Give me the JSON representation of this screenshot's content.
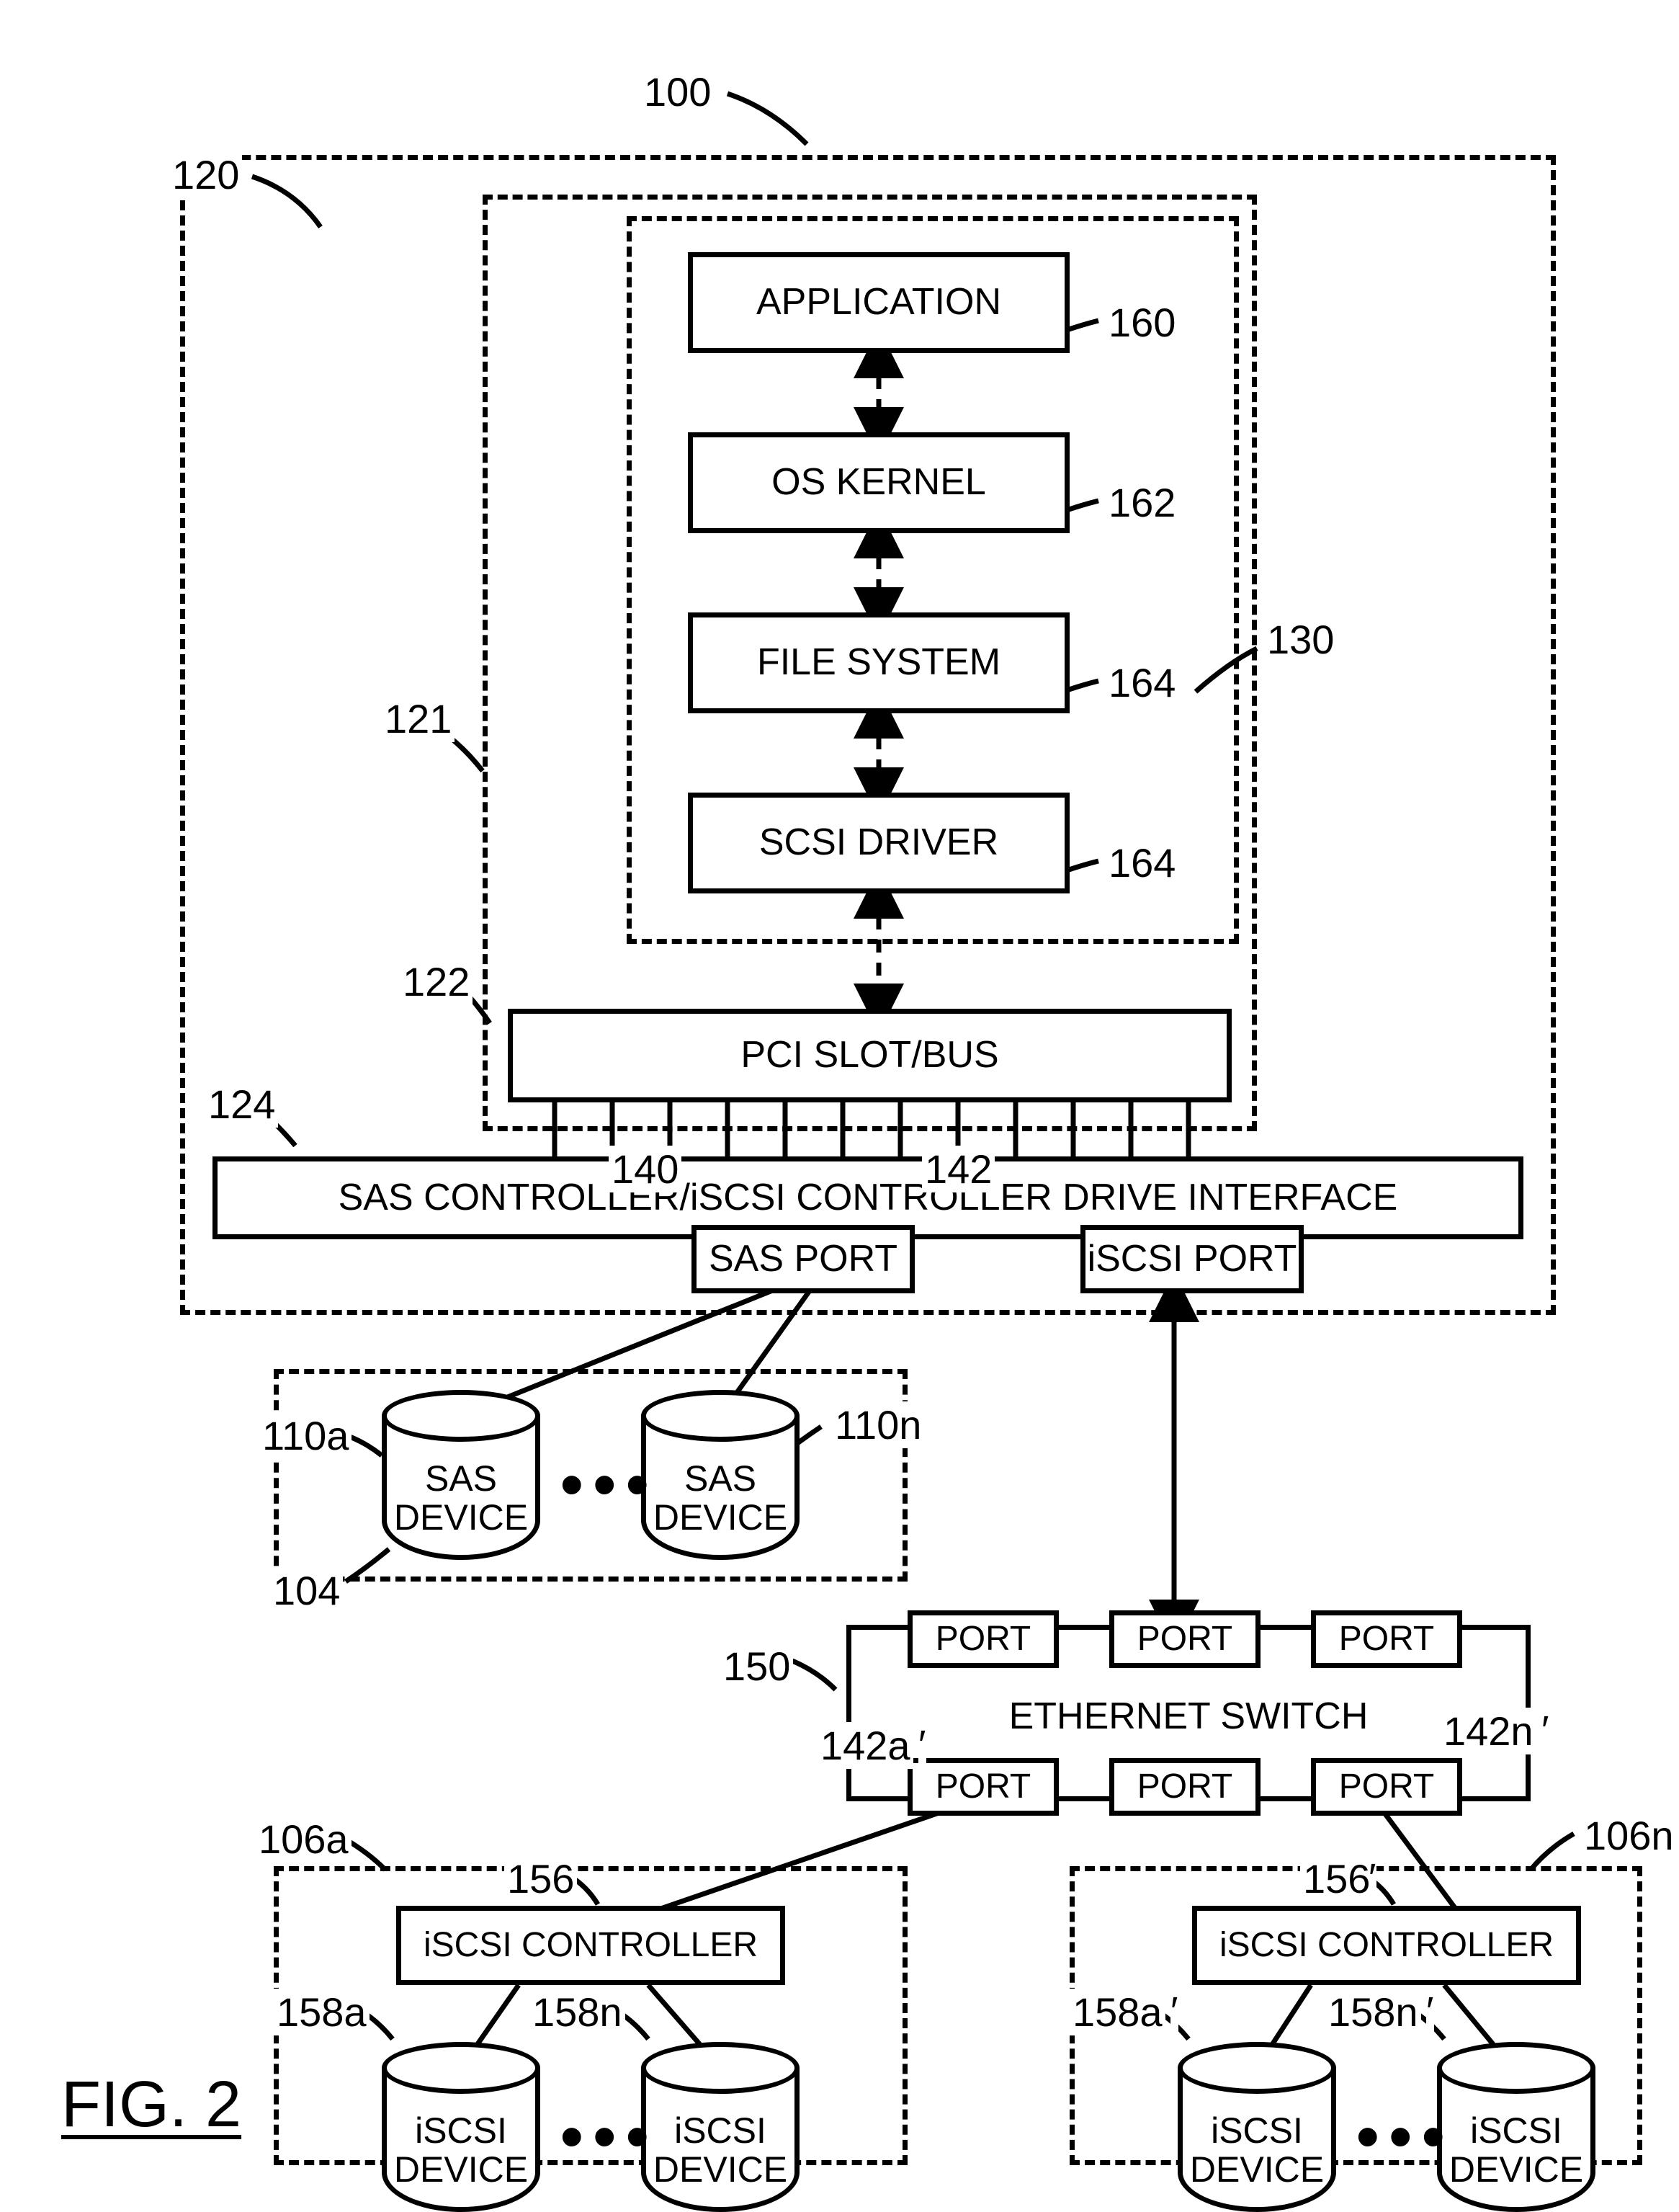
{
  "ref": {
    "r100": "100",
    "r120": "120",
    "r121": "121",
    "r122": "122",
    "r124": "124",
    "r130": "130",
    "r160": "160",
    "r162": "162",
    "r164a": "164",
    "r164b": "164",
    "r140": "140",
    "r142": "142",
    "r104": "104",
    "r110a": "110a",
    "r110n": "110n",
    "r150": "150",
    "r142a": "142a",
    "r142n": "142n",
    "r106a": "106a",
    "r106n": "106n",
    "r156": "156",
    "r156p": "156",
    "r158a": "158a",
    "r158n": "158n",
    "r158ap": "158a",
    "r158np": "158n"
  },
  "blocks": {
    "app": "APPLICATION",
    "osk": "OS KERNEL",
    "fs": "FILE SYSTEM",
    "scsi": "SCSI DRIVER",
    "pci": "PCI SLOT/BUS",
    "ctrl": "SAS CONTROLLER/iSCSI CONTROLLER DRIVE INTERFACE",
    "sasport": "SAS PORT",
    "iscsiport": "iSCSI PORT",
    "ethsw": "ETHERNET SWITCH",
    "port": "PORT",
    "iscsictrl": "iSCSI CONTROLLER"
  },
  "cyl": {
    "sasdev": "SAS\nDEVICE",
    "iscsidev": "iSCSI\nDEVICE"
  },
  "fig": "FIG. 2"
}
